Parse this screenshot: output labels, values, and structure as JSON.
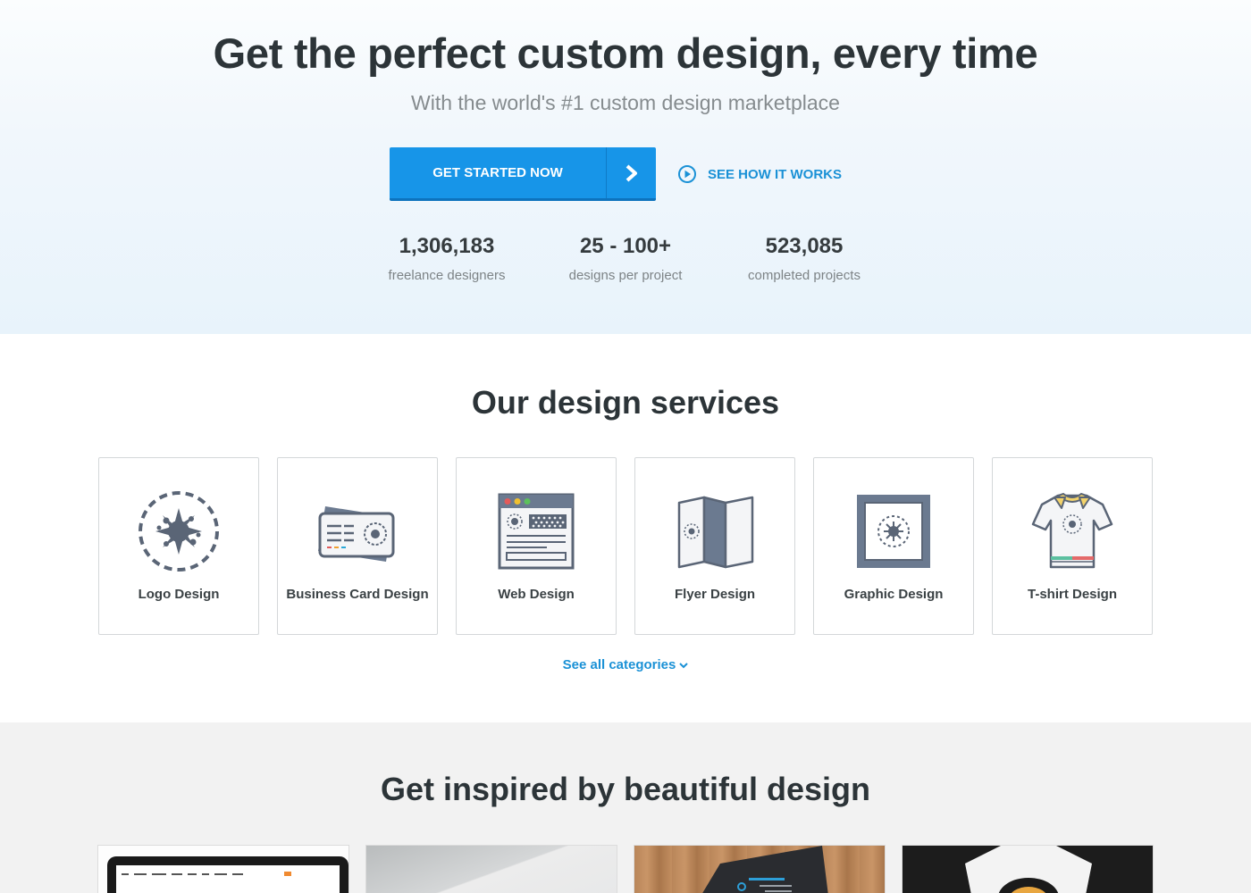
{
  "hero": {
    "title": "Get the perfect custom design, every time",
    "subtitle": "With the world's #1 custom design marketplace",
    "cta_label": "GET STARTED NOW",
    "how_label": "SEE HOW IT WORKS",
    "accent_color": "#1795e8",
    "stats": [
      {
        "value": "1,306,183",
        "label": "freelance designers"
      },
      {
        "value": "25 - 100+",
        "label": "designs per project"
      },
      {
        "value": "523,085",
        "label": "completed projects"
      }
    ]
  },
  "services": {
    "title": "Our design services",
    "items": [
      {
        "label": "Logo Design",
        "icon": "logo-design-icon"
      },
      {
        "label": "Business Card Design",
        "icon": "business-card-icon"
      },
      {
        "label": "Web Design",
        "icon": "web-design-icon"
      },
      {
        "label": "Flyer Design",
        "icon": "flyer-icon"
      },
      {
        "label": "Graphic Design",
        "icon": "graphic-design-icon"
      },
      {
        "label": "T-shirt Design",
        "icon": "tshirt-icon"
      }
    ],
    "see_all_label": "See all categories"
  },
  "inspired": {
    "title": "Get inspired by beautiful design"
  }
}
